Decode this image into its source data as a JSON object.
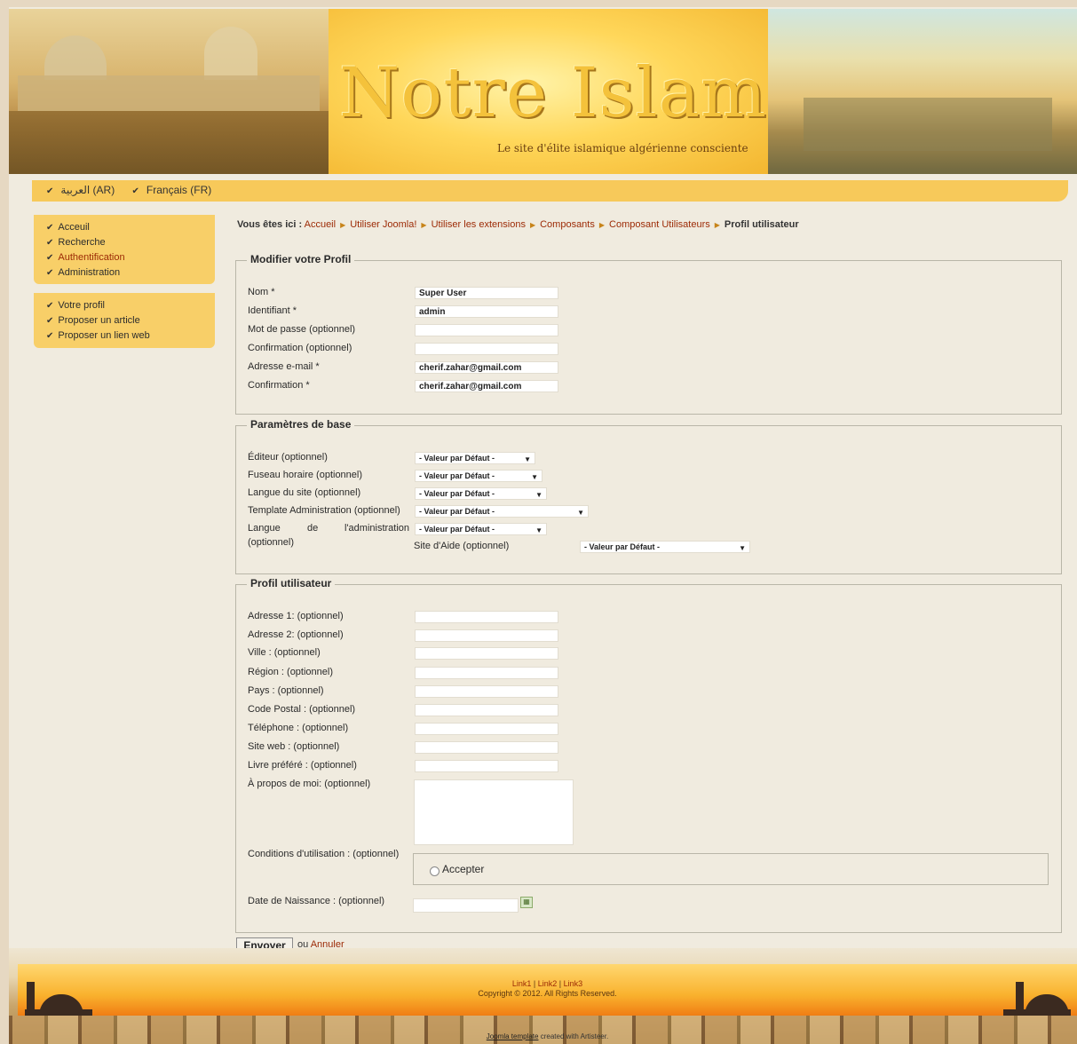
{
  "header": {
    "title": "Notre Islam",
    "tagline": "Le site d'élite islamique algérienne consciente"
  },
  "languages": [
    {
      "label": "العربية (AR)"
    },
    {
      "label": "Français (FR)"
    }
  ],
  "menu_main": [
    {
      "label": "Acceuil"
    },
    {
      "label": "Recherche"
    },
    {
      "label": "Authentification"
    },
    {
      "label": "Administration"
    }
  ],
  "menu_user": [
    {
      "label": "Votre profil"
    },
    {
      "label": "Proposer un article"
    },
    {
      "label": "Proposer un lien web"
    }
  ],
  "breadcrumb": {
    "prefix": "Vous êtes ici :",
    "items": [
      "Accueil",
      "Utiliser Joomla!",
      "Utiliser les extensions",
      "Composants",
      "Composant Utilisateurs"
    ],
    "current": "Profil utilisateur"
  },
  "profile": {
    "legend": "Modifier votre Profil",
    "fields": [
      {
        "label": "Nom *",
        "value": "Super User"
      },
      {
        "label": "Identifiant *",
        "value": "admin"
      },
      {
        "label": "Mot de passe (optionnel)",
        "value": ""
      },
      {
        "label": "Confirmation (optionnel)",
        "value": ""
      },
      {
        "label": "Adresse e-mail *",
        "value": "cherif.zahar@gmail.com"
      },
      {
        "label": "Confirmation *",
        "value": "cherif.zahar@gmail.com"
      }
    ]
  },
  "params": {
    "legend": "Paramètres de base",
    "fields": [
      {
        "label": "Éditeur (optionnel)",
        "value": "- Valeur par Défaut -"
      },
      {
        "label": "Fuseau horaire (optionnel)",
        "value": "- Valeur par Défaut -"
      },
      {
        "label": "Langue du site (optionnel)",
        "value": "- Valeur par Défaut -"
      },
      {
        "label": "Template Administration (optionnel)",
        "value": "- Valeur par Défaut -"
      },
      {
        "label_a": "Langue",
        "label_b": "de",
        "label_c": "l'administration",
        "label_d": "(optionnel)",
        "value": "- Valeur par Défaut -"
      },
      {
        "label": "Site d'Aide (optionnel)",
        "value": "- Valeur par Défaut -"
      }
    ]
  },
  "user_profile": {
    "legend": "Profil utilisateur",
    "fields": [
      {
        "label": "Adresse 1: (optionnel)"
      },
      {
        "label": "Adresse 2: (optionnel)"
      },
      {
        "label": "Ville : (optionnel)"
      },
      {
        "label": "Région : (optionnel)"
      },
      {
        "label": "Pays : (optionnel)"
      },
      {
        "label": "Code Postal : (optionnel)"
      },
      {
        "label": "Téléphone : (optionnel)"
      },
      {
        "label": "Site web : (optionnel)"
      },
      {
        "label": "Livre préféré : (optionnel)"
      }
    ],
    "about_label": "À propos de moi: (optionnel)",
    "tos_label": "Conditions d'utilisation : (optionnel)",
    "tos_option": "Accepter",
    "dob_label": "Date de Naissance : (optionnel)"
  },
  "actions": {
    "submit": "Envoyer",
    "or": "ou",
    "cancel": "Annuler"
  },
  "footer": {
    "link1": "Link1",
    "link2": "Link2",
    "link3": "Link3",
    "sep": "|",
    "copyright": "Copyright © 2012. All Rights Reserved.",
    "credit_link": "Joomla template",
    "credit_text": "created with Artisteer."
  },
  "colors": {
    "accent_link": "#9c2a05",
    "menu_bg": "#f8cf68",
    "header_gold": "#f4c23b"
  }
}
